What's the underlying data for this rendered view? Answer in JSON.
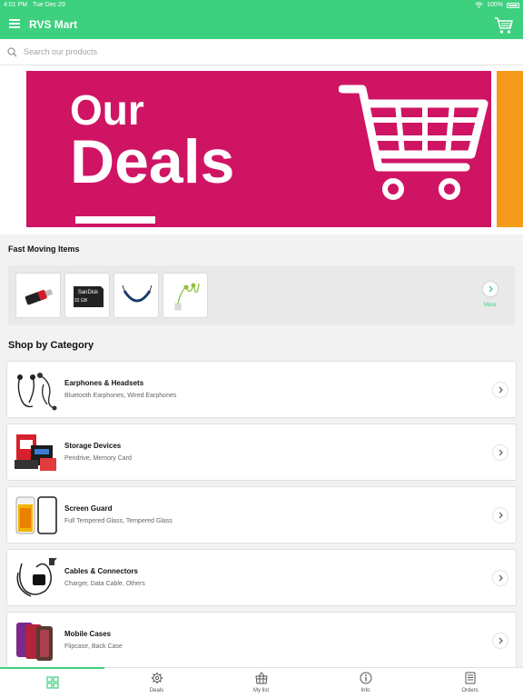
{
  "status_bar": {
    "time": "4:01 PM",
    "date": "Tue Dec 29",
    "battery": "100%"
  },
  "app": {
    "title": "RVS Mart"
  },
  "search": {
    "placeholder": "Search our products"
  },
  "banner": {
    "line1": "Our",
    "line2": "Deals"
  },
  "fast_moving": {
    "title": "Fast Moving Items",
    "items": [
      {
        "icon": "pendrive-icon"
      },
      {
        "icon": "memory-card-icon",
        "brand": "SanDisk",
        "capacity": "32 GB"
      },
      {
        "icon": "neckband-earphone-icon"
      },
      {
        "icon": "earphones-icon"
      }
    ],
    "more_label": "More"
  },
  "categories": {
    "title": "Shop by Category",
    "items": [
      {
        "name": "Earphones & Headsets",
        "sub": "Bluetooth Earphones, Wired Earphones",
        "icon": "earphones-icon"
      },
      {
        "name": "Storage Devices",
        "sub": "Pendrive, Memory Card",
        "icon": "storage-icon"
      },
      {
        "name": "Screen Guard",
        "sub": "Full Tempered Glass, Tempered Glass",
        "icon": "screen-guard-icon"
      },
      {
        "name": "Cables & Connectors",
        "sub": "Charger, Data Cable, Others",
        "icon": "cable-icon"
      },
      {
        "name": "Mobile Cases",
        "sub": "Flipcase, Back Case",
        "icon": "mobile-case-icon"
      }
    ]
  },
  "tabs": [
    {
      "label": "",
      "icon": "grid-icon",
      "active": true
    },
    {
      "label": "Deals",
      "icon": "gear-icon"
    },
    {
      "label": "My list",
      "icon": "basket-icon"
    },
    {
      "label": "Info",
      "icon": "info-icon"
    },
    {
      "label": "Orders",
      "icon": "orders-icon"
    }
  ],
  "colors": {
    "brand": "#3dd07e",
    "banner": "#cf1463",
    "banner_next": "#f69a1c"
  }
}
